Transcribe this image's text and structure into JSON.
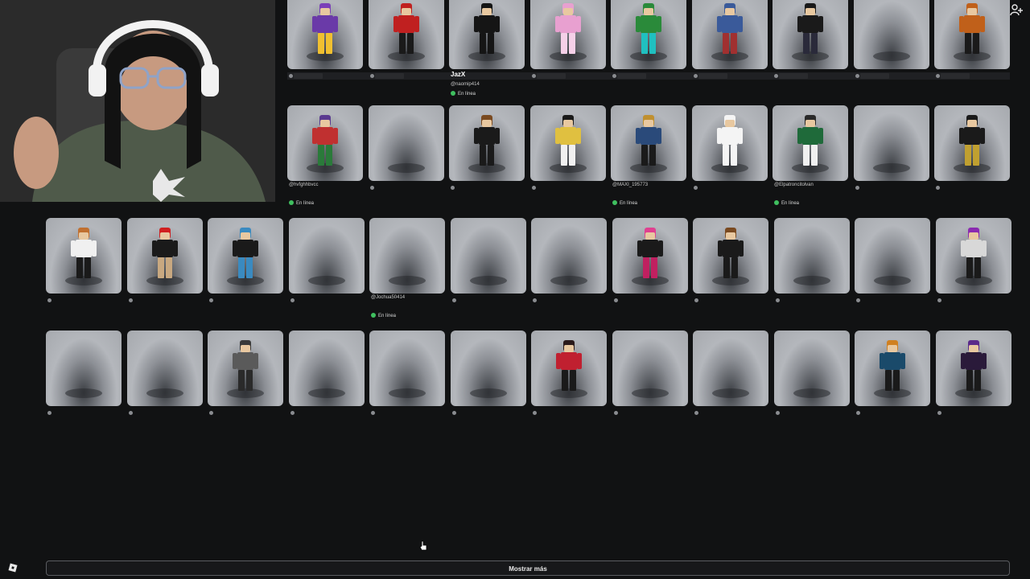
{
  "header": {
    "search_icon": "search-icon",
    "add_friend_icon": "add-friend-icon"
  },
  "rows": [
    {
      "cards": [
        {
          "name": "",
          "handle": "",
          "online": false,
          "placeholder": true,
          "avatar": "purple-outfit"
        },
        {
          "name": "",
          "handle": "",
          "online": false,
          "placeholder": true,
          "avatar": "red-black"
        },
        {
          "name": "JazX",
          "handle": "@naomip414",
          "online": true,
          "placeholder": false,
          "avatar": "black-suit"
        },
        {
          "name": "",
          "handle": "",
          "online": false,
          "placeholder": true,
          "avatar": "pink"
        },
        {
          "name": "",
          "handle": "",
          "online": false,
          "placeholder": true,
          "avatar": "green-cyan"
        },
        {
          "name": "",
          "handle": "",
          "online": false,
          "placeholder": true,
          "avatar": "blue-small"
        },
        {
          "name": "",
          "handle": "",
          "online": false,
          "placeholder": true,
          "avatar": "dark-small"
        },
        {
          "name": "",
          "handle": "",
          "online": false,
          "placeholder": true,
          "avatar": "empty"
        },
        {
          "name": "",
          "handle": "",
          "online": false,
          "placeholder": true,
          "avatar": "orange-black"
        }
      ]
    },
    {
      "cards": [
        {
          "name": "",
          "handle": "@hvfghhbvcc",
          "online": true,
          "placeholder": false,
          "avatar": "colorful"
        },
        {
          "name": "",
          "handle": "",
          "online": false,
          "placeholder": false,
          "avatar": "empty"
        },
        {
          "name": "",
          "handle": "",
          "online": false,
          "placeholder": false,
          "avatar": "black-brown"
        },
        {
          "name": "",
          "handle": "",
          "online": false,
          "placeholder": false,
          "avatar": "blonde"
        },
        {
          "name": "",
          "handle": "@MAXI_195773",
          "online": true,
          "placeholder": false,
          "avatar": "cowboy"
        },
        {
          "name": "",
          "handle": "",
          "online": false,
          "placeholder": false,
          "avatar": "white-blocky"
        },
        {
          "name": "",
          "handle": "@Elpatroncitolvan",
          "online": true,
          "placeholder": false,
          "avatar": "green-jersey"
        },
        {
          "name": "",
          "handle": "",
          "online": false,
          "placeholder": false,
          "avatar": "empty"
        },
        {
          "name": "",
          "handle": "",
          "online": false,
          "placeholder": false,
          "avatar": "black-gold"
        }
      ]
    },
    {
      "cards": [
        {
          "name": "",
          "handle": "",
          "online": false,
          "avatar": "white-shirt"
        },
        {
          "name": "",
          "handle": "",
          "online": false,
          "avatar": "red-cap"
        },
        {
          "name": "",
          "handle": "",
          "online": false,
          "avatar": "blue-skin"
        },
        {
          "name": "",
          "handle": "",
          "online": false,
          "avatar": "empty"
        },
        {
          "name": "",
          "handle": "@Jochua50414",
          "online": true,
          "avatar": "empty"
        },
        {
          "name": "",
          "handle": "",
          "online": false,
          "avatar": "empty"
        },
        {
          "name": "",
          "handle": "",
          "online": false,
          "avatar": "empty"
        },
        {
          "name": "",
          "handle": "",
          "online": false,
          "avatar": "pink-hair"
        },
        {
          "name": "",
          "handle": "",
          "online": false,
          "avatar": "black-brown"
        },
        {
          "name": "",
          "handle": "",
          "online": false,
          "avatar": "empty"
        },
        {
          "name": "",
          "handle": "",
          "online": false,
          "avatar": "empty"
        },
        {
          "name": "",
          "handle": "",
          "online": false,
          "avatar": "white-purple"
        }
      ]
    },
    {
      "cards": [
        {
          "name": "",
          "handle": "",
          "online": false,
          "avatar": "empty"
        },
        {
          "name": "",
          "handle": "",
          "online": false,
          "avatar": "empty"
        },
        {
          "name": "",
          "handle": "",
          "online": false,
          "avatar": "hat-grey"
        },
        {
          "name": "",
          "handle": "",
          "online": false,
          "avatar": "empty"
        },
        {
          "name": "",
          "handle": "",
          "online": false,
          "avatar": "empty"
        },
        {
          "name": "",
          "handle": "",
          "online": false,
          "avatar": "empty"
        },
        {
          "name": "",
          "handle": "",
          "online": false,
          "avatar": "red-hoodie"
        },
        {
          "name": "",
          "handle": "",
          "online": false,
          "avatar": "empty"
        },
        {
          "name": "",
          "handle": "",
          "online": false,
          "avatar": "empty"
        },
        {
          "name": "",
          "handle": "",
          "online": false,
          "avatar": "empty"
        },
        {
          "name": "",
          "handle": "",
          "online": false,
          "avatar": "blue-orange"
        },
        {
          "name": "",
          "handle": "",
          "online": false,
          "avatar": "dark-purple"
        }
      ]
    }
  ],
  "status_online_label": "En línea",
  "show_more_label": "Mostrar más",
  "footer": {
    "logo_icon": "roblox-logo-icon"
  },
  "colors": {
    "online": "#3fbf5f",
    "background": "#111213",
    "card": "#a6a9ae"
  }
}
